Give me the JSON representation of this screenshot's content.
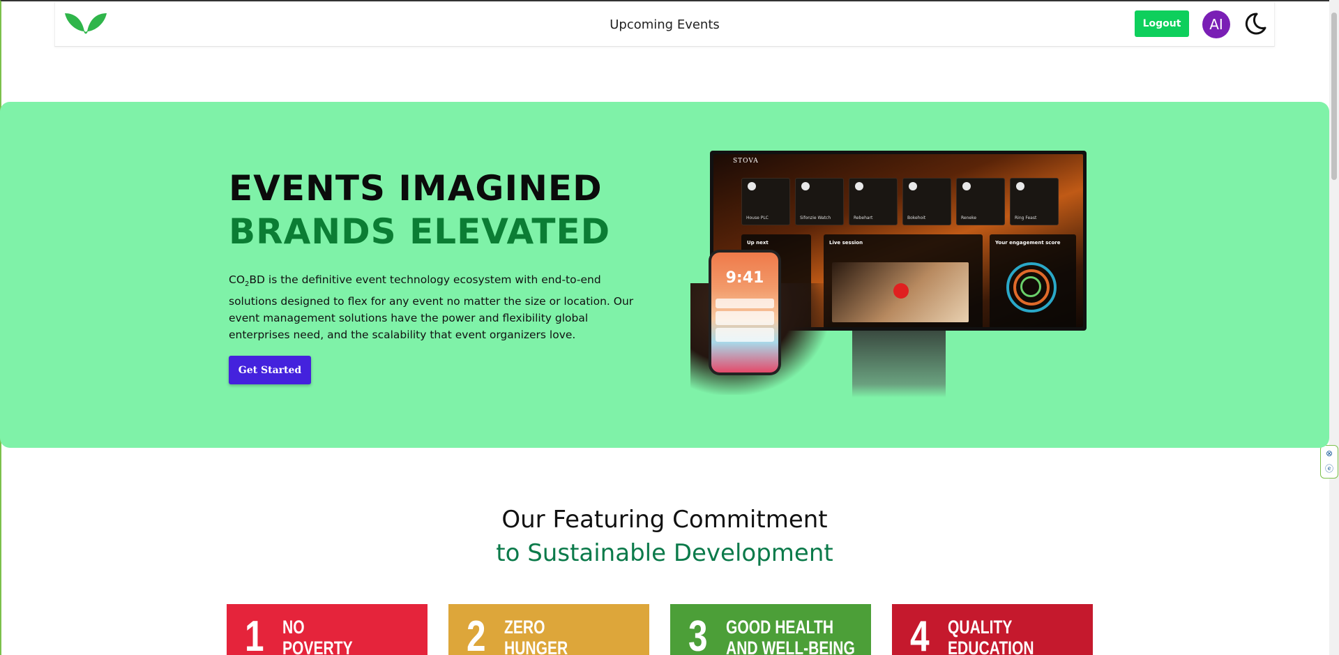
{
  "header": {
    "title": "Upcoming Events",
    "logout_label": "Logout",
    "avatar_initials": "AI",
    "logo_icon": "leaf-logo-icon",
    "theme_icon": "moon-icon",
    "accent_color": "#0ecf5c"
  },
  "hero": {
    "headline_line1": "EVENTS IMAGINED",
    "headline_line2": "BRANDS ELEVATED",
    "description_prefix": "CO",
    "description_sub": "2",
    "description_rest": "BD is the definitive event technology ecosystem with end-to-end solutions designed to flex for any event no matter the size or location. Our event management solutions have the power and flexibility global enterprises need, and the scalability that event organizers love.",
    "cta_label": "Get Started",
    "background_color": "#7ff2a8",
    "illustration": {
      "screen_brand": "STOVA",
      "tiles": [
        "House PLC",
        "Sifonzie Watch",
        "Rebehart",
        "Bokehoit",
        "Reneke",
        "Ring Feast"
      ],
      "panels": [
        "Up next",
        "Live session",
        "Your engagement score"
      ],
      "phone_time": "9:41"
    }
  },
  "features": {
    "heading_line1": "Our Featuring Commitment",
    "heading_line2": "to Sustainable Development",
    "cards": [
      {
        "number": "1",
        "title": "NO\nPOVERTY",
        "color": "#e5243b"
      },
      {
        "number": "2",
        "title": "ZERO\nHUNGER",
        "color": "#dda63a"
      },
      {
        "number": "3",
        "title": "GOOD HEALTH\nAND WELL-BEING",
        "color": "#4c9f38"
      },
      {
        "number": "4",
        "title": "QUALITY\nEDUCATION",
        "color": "#c5192d"
      }
    ]
  }
}
